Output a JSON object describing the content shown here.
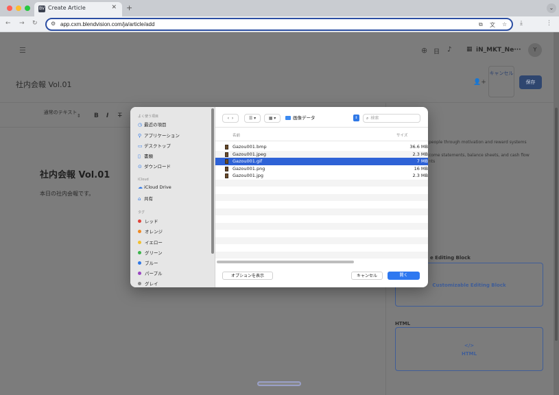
{
  "browser": {
    "tab_title": "Create Article",
    "tab_favicon": "BV",
    "url": "app.cxm.blendvision.com/ja/article/add",
    "new_tab": "+",
    "tab_close": "✕"
  },
  "header": {
    "language": "日",
    "workspace": "iN_MKT_Ne···",
    "avatar": "Y"
  },
  "page": {
    "title": "社内会報 Vol.01",
    "cancel_label": "キャンセル",
    "save_label": "保存",
    "toolbar_style": "通常のテキスト",
    "toolbar_bold": "B",
    "toolbar_italic": "I",
    "toolbar_strike": "T"
  },
  "document": {
    "heading": "社内会報 Vol.01",
    "body": "本日の社内会報です。"
  },
  "right_panel": {
    "text1": "people through motivation and reward systems",
    "text2": "come statements, balance sheets, and cash flow",
    "text3": "nts",
    "section": "e Editing Block",
    "card1": "Customizable Editing Block",
    "html_section": "HTML",
    "card2_icon": "</>",
    "card2": "HTML"
  },
  "dialog": {
    "sidebar": {
      "favorites_header": "よく使う項目",
      "favorites": [
        {
          "icon": "clock-icon",
          "glyph": "◷",
          "label": "最近の項目"
        },
        {
          "icon": "apps-icon",
          "glyph": "⚲",
          "label": "アプリケーション"
        },
        {
          "icon": "desktop-icon",
          "glyph": "▭",
          "label": "デスクトップ"
        },
        {
          "icon": "document-icon",
          "glyph": "▯",
          "label": "書類"
        },
        {
          "icon": "download-icon",
          "glyph": "⊙",
          "label": "ダウンロード"
        }
      ],
      "icloud_header": "iCloud",
      "icloud": [
        {
          "icon": "cloud-icon",
          "glyph": "☁",
          "label": "iCloud Drive"
        },
        {
          "icon": "shared-folder-icon",
          "glyph": "⌂",
          "label": "共有"
        }
      ],
      "tags_header": "タグ",
      "tags": [
        {
          "label": "レッド",
          "color": "#e0443a"
        },
        {
          "label": "オレンジ",
          "color": "#f08a24"
        },
        {
          "label": "イエロー",
          "color": "#f2c12e"
        },
        {
          "label": "グリーン",
          "color": "#3bb54a"
        },
        {
          "label": "ブルー",
          "color": "#2f78e6"
        },
        {
          "label": "パープル",
          "color": "#9a45c2"
        },
        {
          "label": "グレイ",
          "color": "#8a8a8a"
        }
      ]
    },
    "toolbar": {
      "back": "‹",
      "forward": "›",
      "list_view": "☰ ▾",
      "grid_view": "▦ ▾",
      "folder": "画像データ",
      "search_placeholder": "検索"
    },
    "columns": {
      "name": "名前",
      "size": "サイズ"
    },
    "files": [
      {
        "name": "Gazou001.bmp",
        "size": "36.6 MB"
      },
      {
        "name": "Gazou001.jpeg",
        "size": "2.3 MB"
      },
      {
        "name": "Gazou001.gif",
        "size": "7 MB"
      },
      {
        "name": "Gazou001.png",
        "size": "16 MB"
      },
      {
        "name": "Gazou001.jpg",
        "size": "2.3 MB"
      }
    ],
    "selected_file": "Gazou001.gif",
    "options_button": "オプションを表示",
    "cancel_button": "キャンセル",
    "open_button": "開く"
  },
  "colors": {
    "accent": "#2e78f0",
    "selection": "#2e62d6"
  }
}
